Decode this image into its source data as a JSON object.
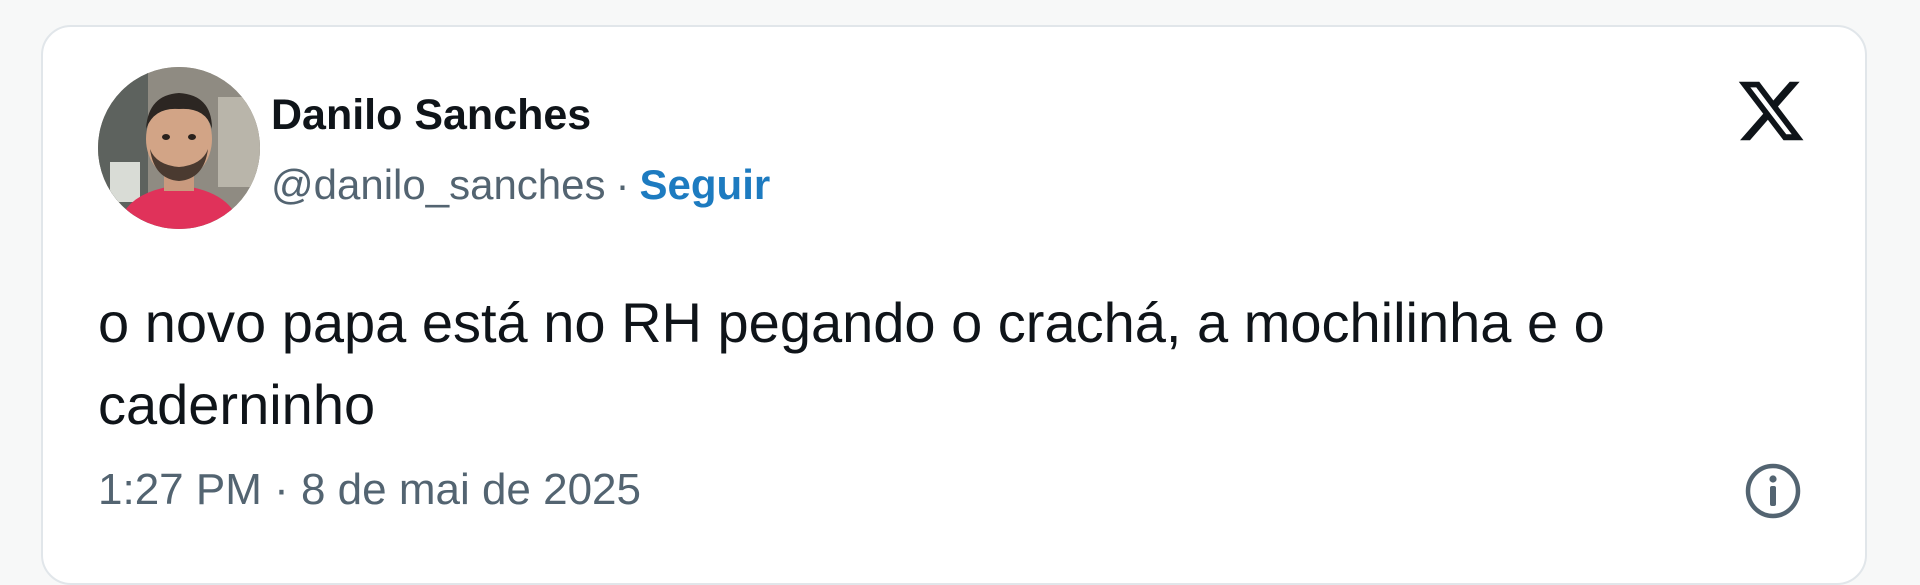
{
  "author": {
    "name": "Danilo Sanches",
    "handle": "@danilo_sanches",
    "separator": "·",
    "follow_label": "Seguir",
    "avatar_icon": "profile-photo"
  },
  "brand": {
    "logo_icon": "x-logo-icon",
    "accent_color": "#1d7bc0"
  },
  "tweet": {
    "text": "o novo papa está no RH pegando o crachá, a mochilinha e o caderninho",
    "timestamp": "1:27 PM · 8 de mai de 2025"
  },
  "icons": {
    "info": "info-icon"
  }
}
